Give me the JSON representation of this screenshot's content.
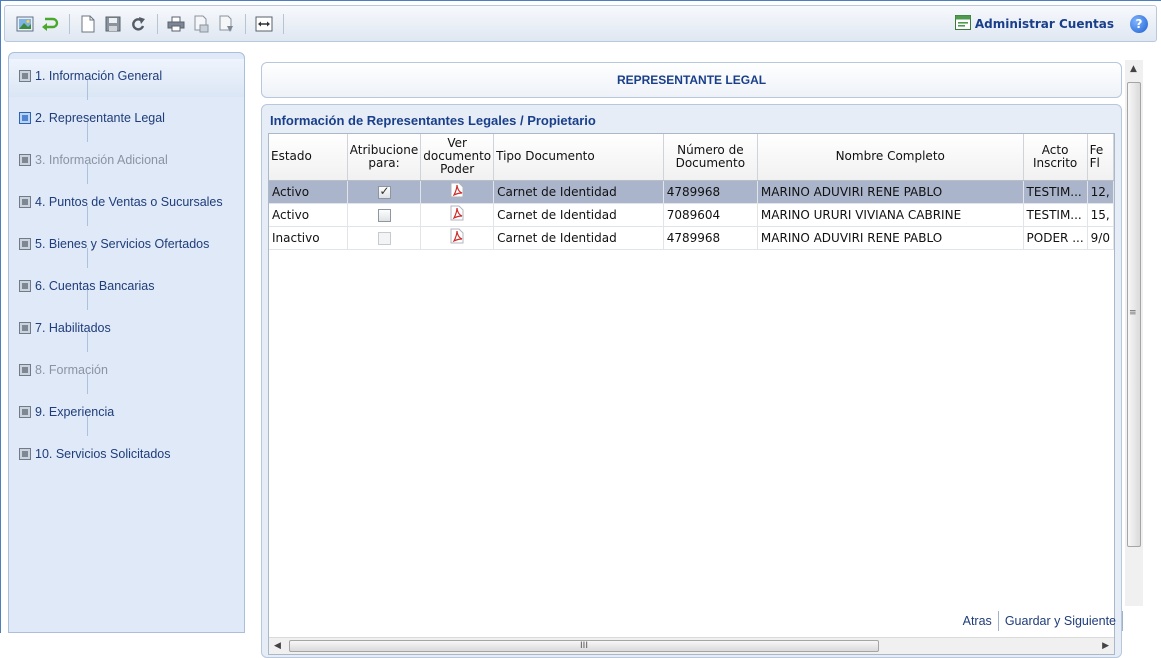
{
  "toolbar": {
    "icons": [
      "image-icon",
      "undo-icon",
      "new-document-icon",
      "save-icon",
      "refresh-icon",
      "print-icon",
      "export-icon",
      "export-down-icon",
      "expand-icon"
    ],
    "admin_label": "Administrar Cuentas",
    "help_label": "?"
  },
  "sidebar": {
    "items": [
      {
        "label": "1. Información General",
        "state": "active"
      },
      {
        "label": "2. Representante Legal",
        "state": "current"
      },
      {
        "label": "3. Información Adicional",
        "state": "disabled"
      },
      {
        "label": "4. Puntos de Ventas o Sucursales",
        "state": "normal"
      },
      {
        "label": "5. Bienes y Servicios Ofertados",
        "state": "normal"
      },
      {
        "label": "6. Cuentas Bancarias",
        "state": "normal"
      },
      {
        "label": "7. Habilitados",
        "state": "normal"
      },
      {
        "label": "8. Formación",
        "state": "disabled"
      },
      {
        "label": "9. Experiencia",
        "state": "normal"
      },
      {
        "label": "10. Servicios Solicitados",
        "state": "normal"
      }
    ]
  },
  "main": {
    "title": "REPRESENTANTE LEGAL",
    "grid_title": "Información de Representantes Legales / Propietario",
    "columns": {
      "estado": "Estado",
      "atribuciones_1": "Atribucione",
      "atribuciones_2": "para:",
      "ver_1": "Ver",
      "ver_2": "documento",
      "ver_3": "Poder",
      "tipo": "Tipo Documento",
      "numero_1": "Número de",
      "numero_2": "Documento",
      "nombre": "Nombre Completo",
      "acto_1": "Acto",
      "acto_2": "Inscrito",
      "fecha_1": "Fe",
      "fecha_2": "Fl"
    },
    "rows": [
      {
        "estado": "Activo",
        "atribuciones": "checked",
        "tipo": "Carnet de Identidad",
        "numero": "4789968",
        "nombre": "MARINO ADUVIRI RENE PABLO",
        "acto": "TESTIM...",
        "fecha": "12,"
      },
      {
        "estado": "Activo",
        "atribuciones": "unchecked",
        "tipo": "Carnet de Identidad",
        "numero": "7089604",
        "nombre": "MARINO URURI VIVIANA CABRINE",
        "acto": "TESTIM...",
        "fecha": "15,"
      },
      {
        "estado": "Inactivo",
        "atribuciones": "disabled",
        "tipo": "Carnet de Identidad",
        "numero": "4789968",
        "nombre": "MARINO ADUVIRI RENE PABLO",
        "acto": "PODER ...",
        "fecha": "9/0"
      }
    ],
    "selected_row": 0
  },
  "scroll": {
    "h_grip": "III",
    "v_grip": "≡",
    "left_arrow": "◀",
    "right_arrow": "▶",
    "up_arrow": "▲"
  },
  "footer": {
    "back_label": "Atras",
    "save_next_label": "Guardar y Siguiente"
  },
  "colors": {
    "accent": "#1a3f8a",
    "selected_row": "#aab4cb",
    "sidebar_bg": "#dfe9f7"
  }
}
